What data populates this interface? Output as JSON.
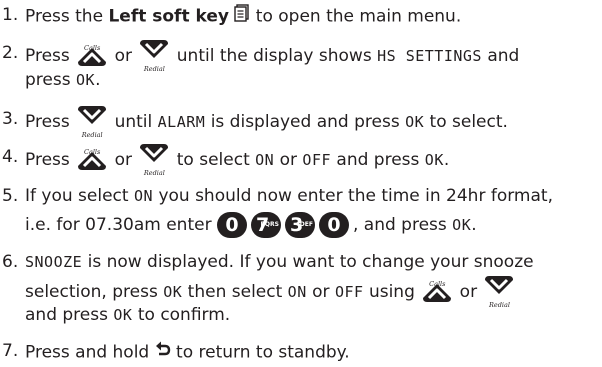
{
  "steps": [
    {
      "num": "1.",
      "t1": "Press the ",
      "b1": "Left soft key",
      "t2": " to open the main menu."
    },
    {
      "num": "2.",
      "t1": "Press",
      "t2": "or",
      "t3": "until the display shows",
      "lcd1": "HS SETTINGS",
      "t4": "and",
      "l2a": "press",
      "lcd2": "OK",
      "l2b": "."
    },
    {
      "num": "3.",
      "t1": "Press",
      "t2": "until",
      "lcd1": "ALARM",
      "t3": "is displayed and press",
      "lcd2": "OK",
      "t4": "to select."
    },
    {
      "num": "4.",
      "t1": "Press",
      "t2": "or",
      "t3": "to select",
      "lcd1": "ON",
      "t4": "or",
      "lcd2": "OFF",
      "t5": "and press",
      "lcd3": "OK",
      "t6": "."
    },
    {
      "num": "5.",
      "t1": "If you select",
      "lcd1": "ON",
      "t2": "you should now enter the time in 24hr format,",
      "l2a": "i.e. for 07.30am enter",
      "l2b": ", and press",
      "lcd2": "OK",
      "l2c": "."
    },
    {
      "num": "6.",
      "lcd1": "SNOOZE",
      "t1": "is now displayed. If you want to change your snooze",
      "l2a": "selection, press",
      "lcd2": "OK",
      "l2b": "then select",
      "lcd3": "ON",
      "l2c": "or",
      "lcd4": "OFF",
      "l2d": "using",
      "l2e": "or",
      "l3a": "and press",
      "lcd5": "OK",
      "l3b": "to confirm."
    },
    {
      "num": "7.",
      "t1": "Press and hold",
      "t2": "to return to standby."
    }
  ],
  "keypad": {
    "d0": "0",
    "d7": "7",
    "d7_sup": "PQRS",
    "d3": "3",
    "d3_sup": "DEF",
    "d0b": "0"
  },
  "icons": {
    "calls_label": "Calls",
    "redial_label": "Redial",
    "up": "nav-up-icon",
    "down": "nav-down-icon",
    "menu": "menu-key-icon",
    "back": "back-key-icon"
  }
}
